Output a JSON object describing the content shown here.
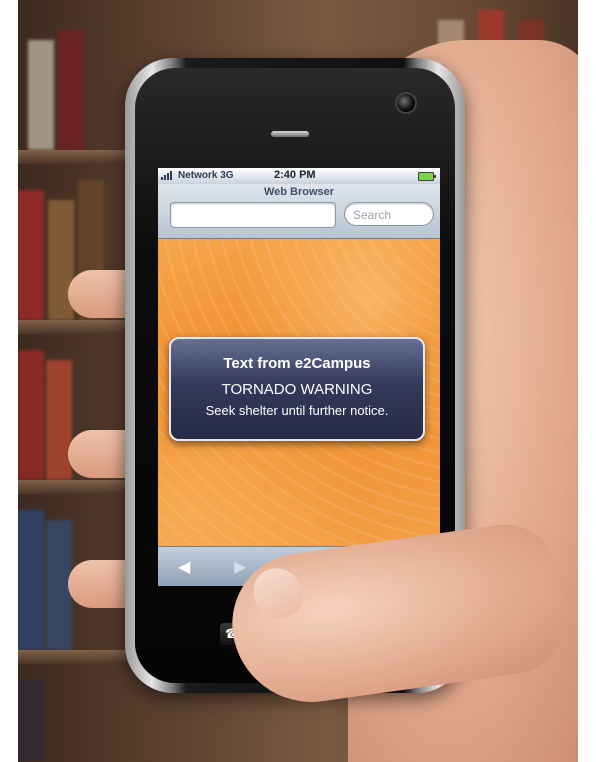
{
  "status_bar": {
    "carrier": "Network 3G",
    "time": "2:40 PM"
  },
  "browser": {
    "title": "Web Browser",
    "url_value": "",
    "search_placeholder": "Search"
  },
  "alert": {
    "title": "Text from e2Campus",
    "line1": "TORNADO WARNING",
    "line2": "Seek shelter until further notice."
  },
  "toolbar": {
    "back_icon": "back-arrow-icon",
    "forward_icon": "forward-arrow-icon"
  },
  "icons": {
    "signal": "signal-strength-icon",
    "battery": "battery-icon",
    "call": "phone-call-icon",
    "home": "home-button-icon",
    "camera": "front-camera-icon",
    "speaker": "earpiece-speaker-icon"
  },
  "colors": {
    "screen_orange": "#f29a3a",
    "alert_navy": "#2c365c",
    "browser_bar": "#b7c4d4"
  }
}
